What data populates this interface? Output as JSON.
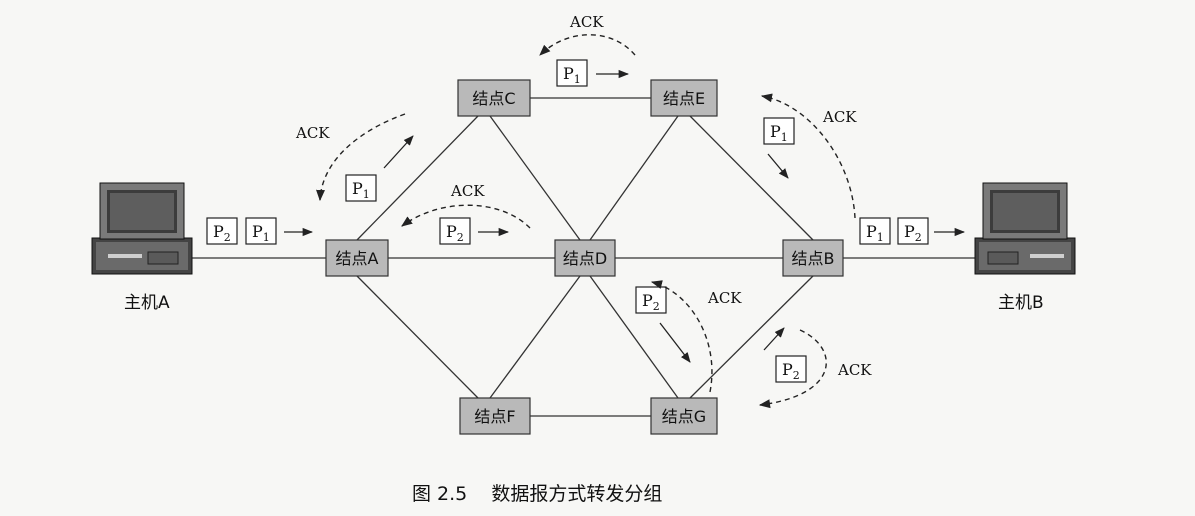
{
  "caption": "图 2.5    数据报方式转发分组",
  "hosts": {
    "a": "主机A",
    "b": "主机B"
  },
  "nodes": {
    "a": "结点A",
    "b": "结点B",
    "c": "结点C",
    "d": "结点D",
    "e": "结点E",
    "f": "结点F",
    "g": "结点G"
  },
  "packets": {
    "p1": "P",
    "p2": "P",
    "sub1": "1",
    "sub2": "2"
  },
  "ack": "ACK"
}
